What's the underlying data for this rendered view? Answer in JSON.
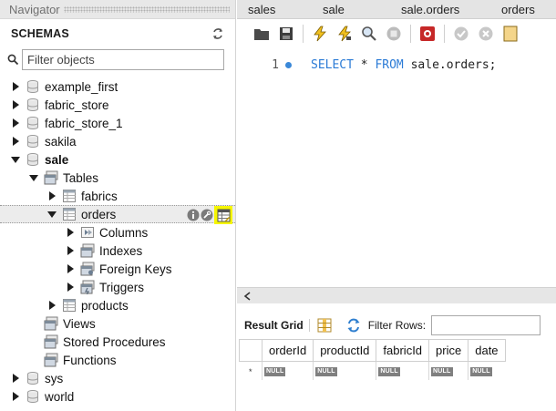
{
  "navigator": {
    "title": "Navigator",
    "schemas_label": "SCHEMAS",
    "search": {
      "placeholder": "Filter objects",
      "value": ""
    },
    "tree": [
      {
        "label": "example_first",
        "type": "schema",
        "expanded": false,
        "depth": 0
      },
      {
        "label": "fabric_store",
        "type": "schema",
        "expanded": false,
        "depth": 0
      },
      {
        "label": "fabric_store_1",
        "type": "schema",
        "expanded": false,
        "depth": 0
      },
      {
        "label": "sakila",
        "type": "schema",
        "expanded": false,
        "depth": 0
      },
      {
        "label": "sale",
        "type": "schema",
        "expanded": true,
        "depth": 0,
        "bold": true
      },
      {
        "label": "Tables",
        "type": "folder",
        "expanded": true,
        "depth": 1
      },
      {
        "label": "fabrics",
        "type": "table",
        "expanded": false,
        "depth": 2
      },
      {
        "label": "orders",
        "type": "table",
        "expanded": true,
        "depth": 2,
        "selected": true
      },
      {
        "label": "Columns",
        "type": "columns",
        "expanded": false,
        "depth": 3
      },
      {
        "label": "Indexes",
        "type": "indexes",
        "expanded": false,
        "depth": 3
      },
      {
        "label": "Foreign Keys",
        "type": "fkeys",
        "expanded": false,
        "depth": 3
      },
      {
        "label": "Triggers",
        "type": "triggers",
        "expanded": false,
        "depth": 3
      },
      {
        "label": "products",
        "type": "table",
        "expanded": false,
        "depth": 2
      },
      {
        "label": "Views",
        "type": "folder",
        "expanded": null,
        "depth": 1
      },
      {
        "label": "Stored Procedures",
        "type": "folder",
        "expanded": null,
        "depth": 1
      },
      {
        "label": "Functions",
        "type": "folder",
        "expanded": null,
        "depth": 1
      },
      {
        "label": "sys",
        "type": "schema",
        "expanded": false,
        "depth": 0
      },
      {
        "label": "world",
        "type": "schema",
        "expanded": false,
        "depth": 0
      }
    ],
    "row_actions": [
      "info-icon",
      "wrench-icon",
      "table-data-icon"
    ]
  },
  "editor": {
    "tabs": [
      "sales",
      "sale",
      "sale.orders",
      "orders"
    ],
    "toolbar": [
      "open-folder-icon",
      "save-icon",
      "execute-icon",
      "execute-line-icon",
      "explain-icon",
      "stop-icon",
      "toggle-continue-icon",
      "commit-icon",
      "rollback-icon",
      "toggle-autocommit-icon"
    ],
    "line_number": "1",
    "sql": {
      "kw1": "SELECT",
      "star": " * ",
      "kw2": "FROM",
      "rest": " sale.orders;"
    }
  },
  "results": {
    "result_grid_label": "Result Grid",
    "filter_label": "Filter Rows:",
    "filter_value": "",
    "columns": [
      "orderId",
      "productId",
      "fabricId",
      "price",
      "date"
    ],
    "null_text": "NULL",
    "new_row_marker": "*"
  },
  "colors": {
    "keyword": "#2b7bd6",
    "highlight": "#f6f600",
    "null_badge": "#7f7f7f"
  }
}
